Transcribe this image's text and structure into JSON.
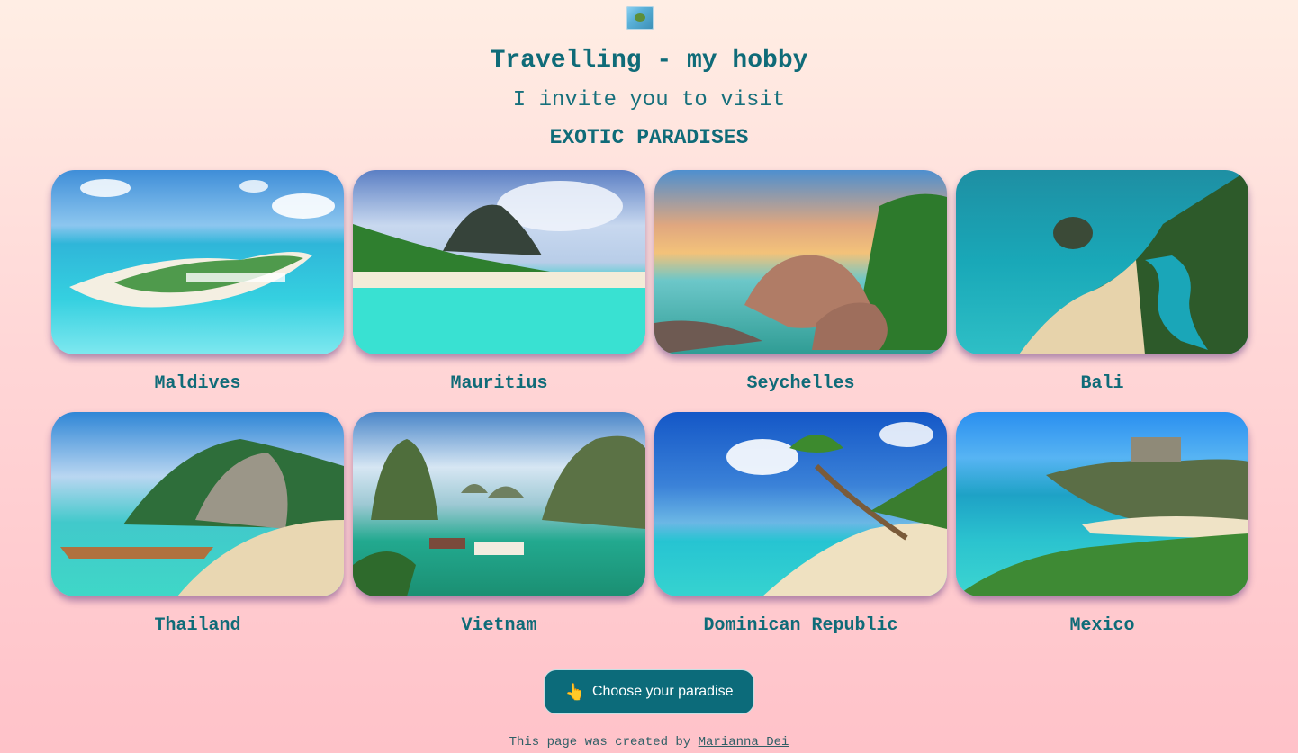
{
  "header": {
    "title": "Travelling - my hobby",
    "subtitle": "I invite you to visit",
    "highlight": "EXOTIC PARADISES"
  },
  "destinations": [
    {
      "name": "Maldives"
    },
    {
      "name": "Mauritius"
    },
    {
      "name": "Seychelles"
    },
    {
      "name": "Bali"
    },
    {
      "name": "Thailand"
    },
    {
      "name": "Vietnam"
    },
    {
      "name": "Dominican Republic"
    },
    {
      "name": "Mexico"
    }
  ],
  "cta": {
    "icon": "pointing-hand-icon",
    "icon_glyph": "👆",
    "label": "Choose your paradise",
    "color": "#0c6b7a"
  },
  "footer": {
    "text": "This page was created by",
    "author": "Marianna Dei"
  },
  "colors": {
    "accent": "#0f6b78",
    "background_top": "#ffeee4",
    "background_bottom": "#ffc2c9"
  }
}
